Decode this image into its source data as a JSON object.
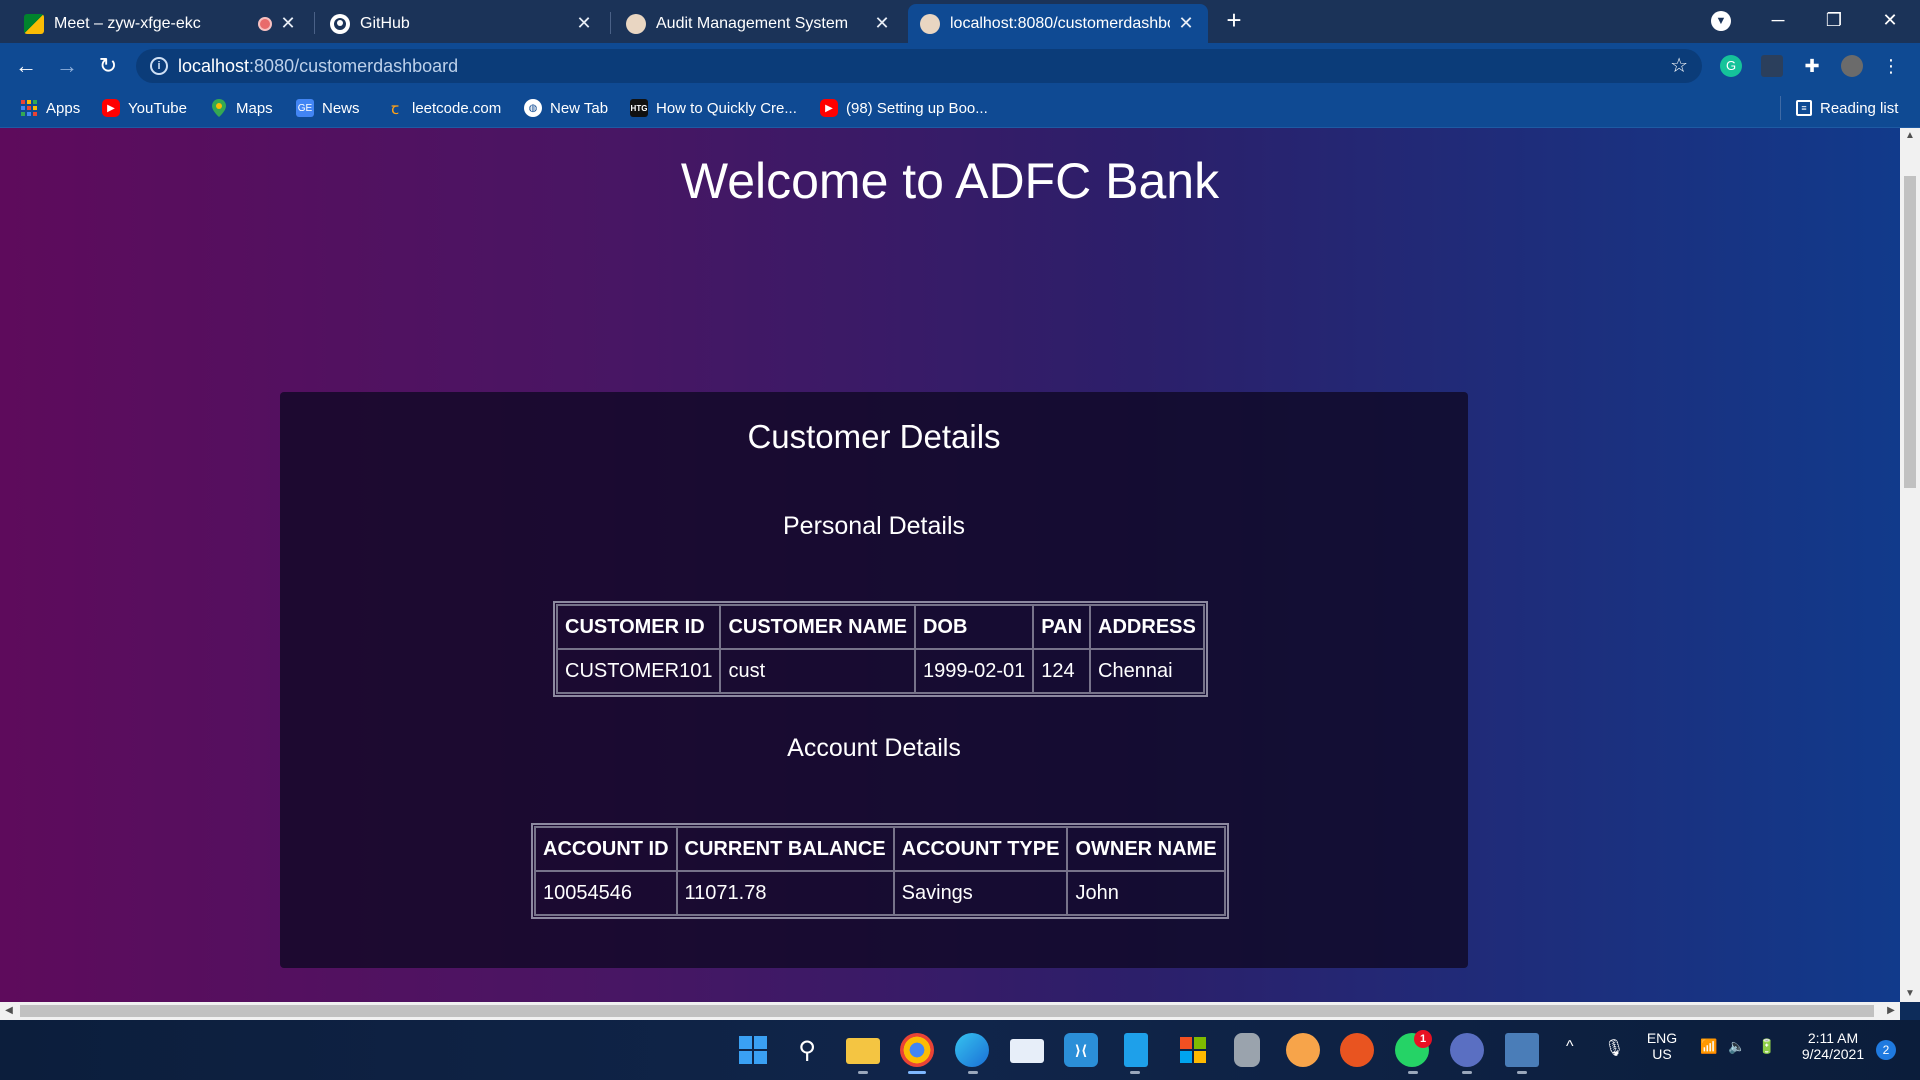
{
  "browser": {
    "tabs": [
      {
        "title": "Meet – zyw-xfge-ekc",
        "icon": "google-meet-icon"
      },
      {
        "title": "GitHub",
        "icon": "github-icon"
      },
      {
        "title": "Audit Management System",
        "icon": "react-icon"
      },
      {
        "title": "localhost:8080/customerdashboa",
        "icon": "react-icon"
      }
    ],
    "url_host": "localhost",
    "url_path": ":8080/customerdashboard",
    "bookmarks": [
      {
        "label": "Apps",
        "icon": "apps-grid-icon"
      },
      {
        "label": "YouTube",
        "icon": "youtube-icon"
      },
      {
        "label": "Maps",
        "icon": "maps-icon"
      },
      {
        "label": "News",
        "icon": "google-news-icon"
      },
      {
        "label": "leetcode.com",
        "icon": "leetcode-icon"
      },
      {
        "label": "New Tab",
        "icon": "globe-icon"
      },
      {
        "label": "How to Quickly Cre...",
        "icon": "htg-icon"
      },
      {
        "label": "(98) Setting up Boo...",
        "icon": "youtube-icon"
      }
    ],
    "reading_list": "Reading list"
  },
  "page": {
    "welcome": "Welcome to ADFC Bank",
    "card_title": "Customer Details",
    "personal": {
      "heading": "Personal Details",
      "headers": [
        "CUSTOMER ID",
        "CUSTOMER NAME",
        "DOB",
        "PAN",
        "ADDRESS"
      ],
      "row": [
        "CUSTOMER101",
        "cust",
        "1999-02-01",
        "124",
        "Chennai"
      ]
    },
    "account": {
      "heading": "Account Details",
      "headers": [
        "ACCOUNT ID",
        "CURRENT BALANCE",
        "ACCOUNT TYPE",
        "OWNER NAME"
      ],
      "row": [
        "10054546",
        "11071.78",
        "Savings",
        "John"
      ]
    }
  },
  "taskbar": {
    "lang_top": "ENG",
    "lang_bottom": "US",
    "time": "2:11 AM",
    "date": "9/24/2021",
    "notification_count": "2",
    "whatsapp_badge": "1"
  }
}
